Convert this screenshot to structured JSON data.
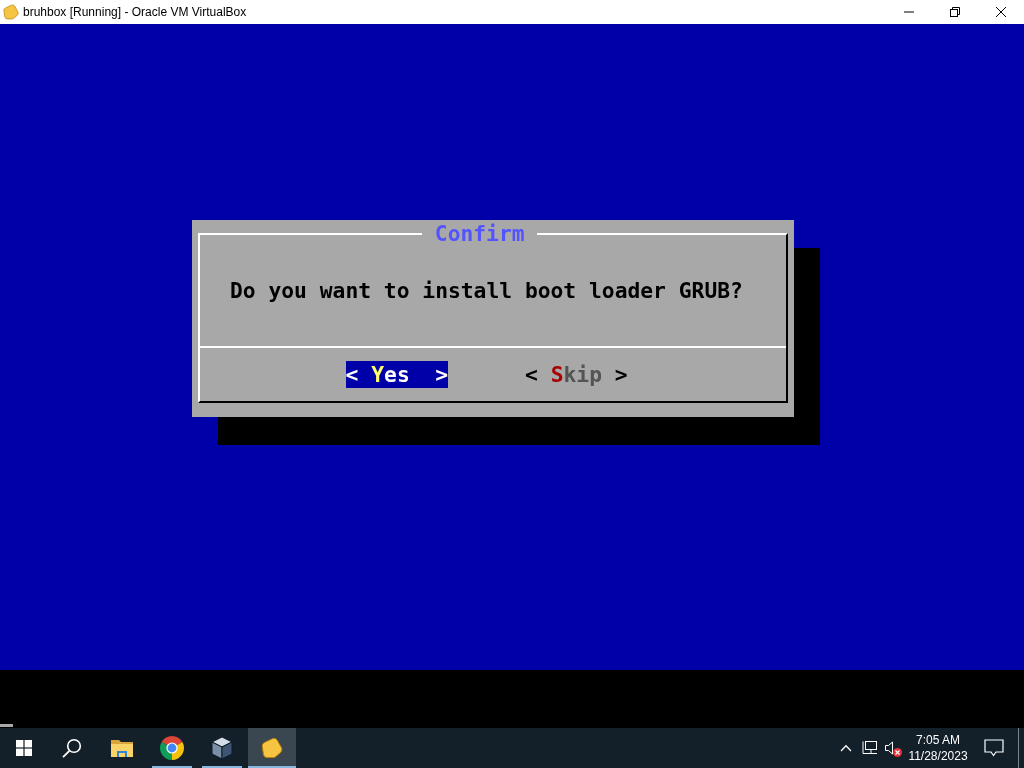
{
  "window": {
    "title": "bruhbox [Running] - Oracle VM VirtualBox"
  },
  "dialog": {
    "title": "Confirm",
    "message": "Do you want to install boot loader GRUB?",
    "buttons": [
      {
        "open": "<",
        "hotkey": "Y",
        "label": "es",
        "close": ">",
        "selected": true
      },
      {
        "open": "<",
        "hotkey": "S",
        "label": "kip",
        "close": ">",
        "selected": false
      }
    ]
  },
  "taskbar": {
    "apps": [
      {
        "kind": "folder",
        "running": false,
        "selected": false
      },
      {
        "kind": "browser",
        "running": true,
        "selected": false
      },
      {
        "kind": "cube",
        "running": true,
        "selected": false
      },
      {
        "kind": "pentagon",
        "running": true,
        "selected": true
      }
    ],
    "tray": {
      "muted": true
    },
    "clock": {
      "time": "7:05 AM",
      "date": "11/28/2023"
    }
  }
}
